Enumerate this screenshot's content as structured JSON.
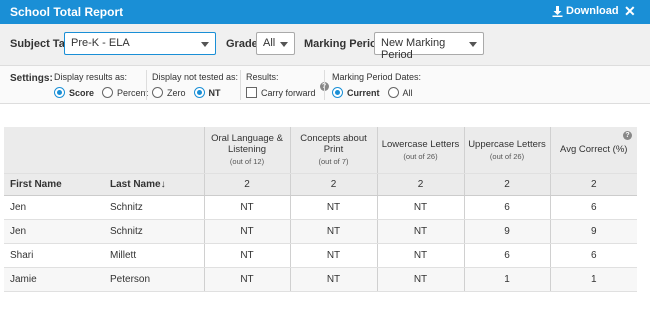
{
  "window": {
    "title": "School Total Report",
    "download_label": "Download",
    "close_glyph": "✕"
  },
  "filters": {
    "subject_tab_label": "Subject Tab:",
    "subject_tab_value": "Pre-K - ELA",
    "grade_label": "Grade:",
    "grade_value": "All",
    "marking_period_label": "Marking Period:",
    "marking_period_value": "New Marking Period"
  },
  "settings": {
    "label": "Settings:",
    "display_results": {
      "title": "Display results as:",
      "options": [
        "Score",
        "Percent"
      ],
      "selected": "Score"
    },
    "display_not_tested": {
      "title": "Display not tested as:",
      "options": [
        "Zero",
        "NT"
      ],
      "selected": "NT"
    },
    "results": {
      "title": "Results:",
      "checkbox_label": "Carry forward",
      "checked": false,
      "help": "?"
    },
    "marking_period_dates": {
      "title": "Marking Period Dates:",
      "options": [
        "Current",
        "All"
      ],
      "selected": "Current"
    }
  },
  "table": {
    "columns": [
      {
        "title": "Oral Language & Listening",
        "sub": "(out of 12)",
        "count": "2"
      },
      {
        "title": "Concepts about Print",
        "sub": "(out of 7)",
        "count": "2"
      },
      {
        "title": "Lowercase Letters",
        "sub": "(out of 26)",
        "count": "2"
      },
      {
        "title": "Uppercase Letters",
        "sub": "(out of 26)",
        "count": "2"
      },
      {
        "title": "Avg Correct (%)",
        "sub": "",
        "count": "2",
        "help": "?"
      }
    ],
    "first_name_header": "First Name",
    "last_name_header": "Last Name",
    "sort_arrow": "🡣",
    "rows": [
      {
        "first": "Jen",
        "last": "Schnitz",
        "values": [
          "NT",
          "NT",
          "NT",
          "6",
          "6"
        ]
      },
      {
        "first": "Jen",
        "last": "Schnitz",
        "values": [
          "NT",
          "NT",
          "NT",
          "9",
          "9"
        ]
      },
      {
        "first": "Shari",
        "last": "Millett",
        "values": [
          "NT",
          "NT",
          "NT",
          "6",
          "6"
        ]
      },
      {
        "first": "Jamie",
        "last": "Peterson",
        "values": [
          "NT",
          "NT",
          "NT",
          "1",
          "1"
        ]
      }
    ]
  },
  "colors": {
    "accent": "#1a8fd6",
    "header_bg": "#ebebeb"
  },
  "icons": {
    "download": "download-icon",
    "close": "close-icon",
    "help": "help-icon",
    "sort": "sort-down-arrow-icon"
  }
}
